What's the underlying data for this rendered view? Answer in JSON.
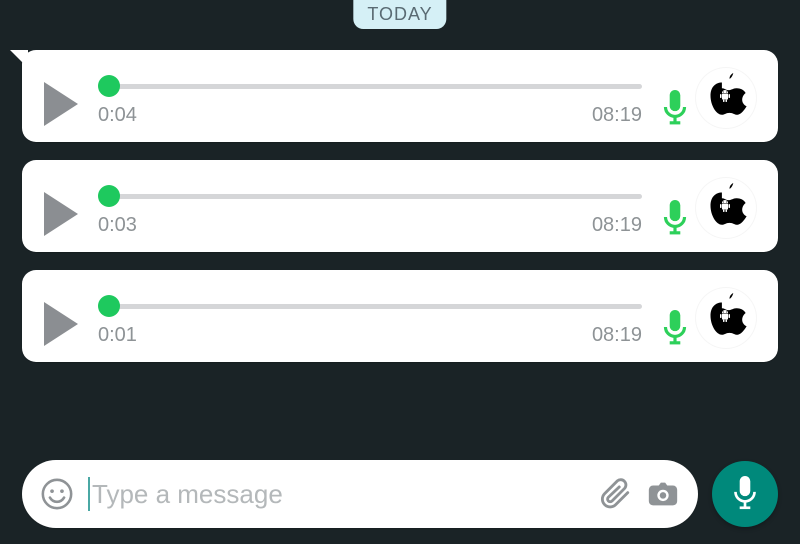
{
  "date_label": "TODAY",
  "messages": [
    {
      "duration": "0:04",
      "time": "08:19",
      "first": true
    },
    {
      "duration": "0:03",
      "time": "08:19",
      "first": false
    },
    {
      "duration": "0:01",
      "time": "08:19",
      "first": false
    }
  ],
  "compose": {
    "placeholder": "Type a message"
  },
  "colors": {
    "accent_green": "#1ec95e",
    "mic_green": "#2dd05a",
    "teal": "#00897b",
    "bg": "#1a2326"
  }
}
